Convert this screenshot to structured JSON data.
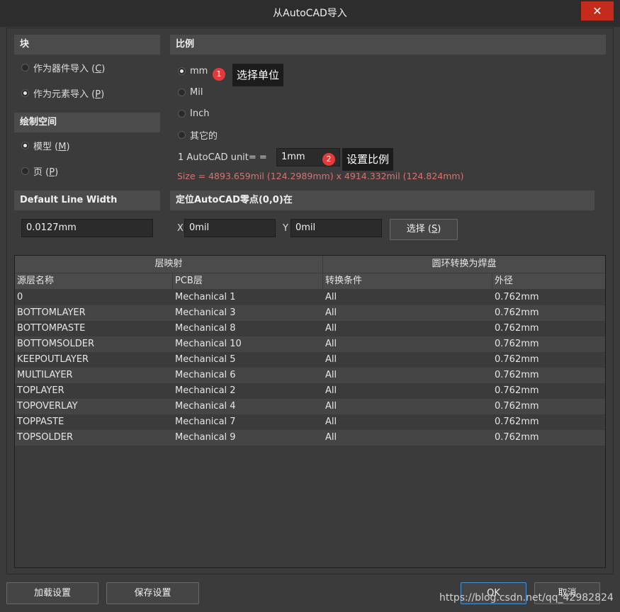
{
  "window": {
    "title": "从AutoCAD导入",
    "close": "✕"
  },
  "block": {
    "header": "块",
    "opt1": {
      "label": "作为器件导入 (",
      "key": "C",
      "end": ")"
    },
    "opt2": {
      "label": "作为元素导入 (",
      "key": "P",
      "end": ")"
    }
  },
  "drawspace": {
    "header": "绘制空间",
    "opt1": {
      "label": "模型 (",
      "key": "M",
      "end": ")"
    },
    "opt2": {
      "label": "页 (",
      "key": "P",
      "end": ")"
    }
  },
  "linewidth": {
    "header": "Default Line Width",
    "value": "0.0127mm"
  },
  "scale": {
    "header": "比例",
    "units": [
      "mm",
      "Mil",
      "Inch",
      "其它的"
    ],
    "unit_label": "1 AutoCAD unit= =",
    "unit_value": "1mm",
    "size_text": "Size = 4893.659mil (124.2989mm) x 4914.332mil (124.824mm)"
  },
  "annotations": {
    "a1": {
      "num": "1",
      "text": "选择单位"
    },
    "a2": {
      "num": "2",
      "text": "设置比例"
    }
  },
  "origin": {
    "header": "定位AutoCAD零点(0,0)在",
    "x_label": "X",
    "x_value": "0mil",
    "y_label": "Y",
    "y_value": "0mil",
    "select_label": "选择 (",
    "select_key": "S",
    "select_end": ")"
  },
  "grid": {
    "group1": "层映射",
    "group2": "圆环转换为焊盘",
    "columns": [
      "源层名称",
      "PCB层",
      "转换条件",
      "外径"
    ],
    "rows": [
      [
        "0",
        "Mechanical 1",
        "All",
        "0.762mm"
      ],
      [
        "BOTTOMLAYER",
        "Mechanical 3",
        "All",
        "0.762mm"
      ],
      [
        "BOTTOMPASTE",
        "Mechanical 8",
        "All",
        "0.762mm"
      ],
      [
        "BOTTOMSOLDER",
        "Mechanical 10",
        "All",
        "0.762mm"
      ],
      [
        "KEEPOUTLAYER",
        "Mechanical 5",
        "All",
        "0.762mm"
      ],
      [
        "MULTILAYER",
        "Mechanical 6",
        "All",
        "0.762mm"
      ],
      [
        "TOPLAYER",
        "Mechanical 2",
        "All",
        "0.762mm"
      ],
      [
        "TOPOVERLAY",
        "Mechanical 4",
        "All",
        "0.762mm"
      ],
      [
        "TOPPASTE",
        "Mechanical 7",
        "All",
        "0.762mm"
      ],
      [
        "TOPSOLDER",
        "Mechanical 9",
        "All",
        "0.762mm"
      ]
    ]
  },
  "footer": {
    "load": "加载设置",
    "save": "保存设置",
    "ok": "OK",
    "cancel": "取消",
    "watermark": "https://blog.csdn.net/qq_42982824"
  }
}
